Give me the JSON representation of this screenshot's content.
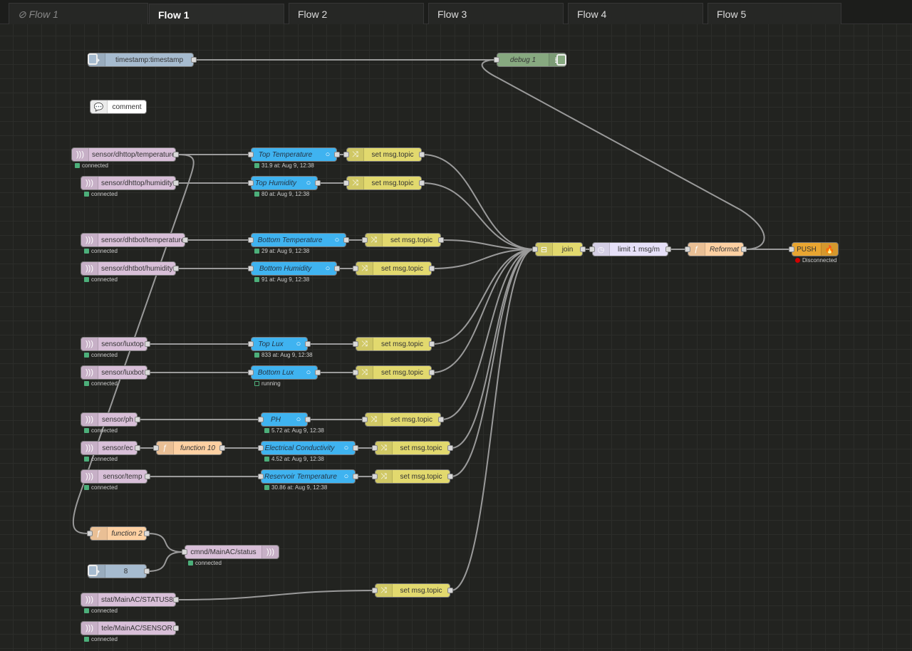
{
  "tabs": [
    {
      "label": "Flow 1",
      "state": "disabled"
    },
    {
      "label": "Flow 1",
      "state": "active"
    },
    {
      "label": "Flow 2"
    },
    {
      "label": "Flow 3"
    },
    {
      "label": "Flow 4"
    },
    {
      "label": "Flow 5"
    }
  ],
  "tab_disabled_icon": "⊘",
  "colors": {
    "inject": "#a6bbcf",
    "debug": "#87a980",
    "comment": "#ffffff",
    "mqtt": "#d8bfd8",
    "ui": "#3fb3f0",
    "change": "#e2d96e",
    "delay": "#e6e0f8",
    "function": "#fdd0a2",
    "push": "#e8a531",
    "status_ok": "#4caf7a",
    "status_err": "#d00000"
  },
  "nodes": {
    "ts": {
      "label": "timestamp:timestamp",
      "icon": "arrow-right-icon"
    },
    "debug": {
      "label": "debug 1",
      "icon": "list-icon"
    },
    "comment": {
      "label": "comment",
      "icon": "speech-bubble-icon"
    },
    "m1": {
      "label": "sensor/dhttop/temperature",
      "status": "connected"
    },
    "m2": {
      "label": "sensor/dhttop/humidity",
      "status": "connected"
    },
    "m3": {
      "label": "sensor/dhtbot/temperature",
      "status": "connected"
    },
    "m4": {
      "label": "sensor/dhtbot/humidity",
      "status": "connected"
    },
    "m5": {
      "label": "sensor/luxtop",
      "status": "connected"
    },
    "m6": {
      "label": "sensor/luxbot",
      "status": "connected"
    },
    "m7": {
      "label": "sensor/ph",
      "status": "connected"
    },
    "m8": {
      "label": "sensor/ec",
      "status": "connected"
    },
    "m9": {
      "label": "sensor/temp",
      "status": "connected"
    },
    "m10": {
      "label": "stat/MainAC/STATUS8",
      "status": "connected"
    },
    "m11": {
      "label": "tele/MainAC/SENSOR",
      "status": "connected"
    },
    "g1": {
      "label": "Top Temperature",
      "status": "31.9 at: Aug 9, 12:38"
    },
    "g2": {
      "label": "Top Humidity",
      "status": "80 at: Aug 9, 12:38"
    },
    "g3": {
      "label": "Bottom Temperature",
      "status": "29 at: Aug 9, 12:38"
    },
    "g4": {
      "label": "Bottom Humidity",
      "status": "91 at: Aug 9, 12:38"
    },
    "g5": {
      "label": "Top Lux",
      "status": "833 at: Aug 9, 12:38"
    },
    "g6": {
      "label": "Bottom Lux",
      "status": "running",
      "status_ring": true
    },
    "g7": {
      "label": "PH",
      "status": "5.72 at: Aug 9, 12:38"
    },
    "g8": {
      "label": "Electrical Conductivity",
      "status": "4.52 at: Aug 9, 12:38"
    },
    "g9": {
      "label": "Reservoir Temperature",
      "status": "30.86 at: Aug 9, 12:38"
    },
    "c1": {
      "label": "set msg.topic"
    },
    "c2": {
      "label": "set msg.topic"
    },
    "c3": {
      "label": "set msg.topic"
    },
    "c4": {
      "label": "set msg.topic"
    },
    "c5": {
      "label": "set msg.topic"
    },
    "c6": {
      "label": "set msg.topic"
    },
    "c7": {
      "label": "set msg.topic"
    },
    "c8": {
      "label": "set msg.topic"
    },
    "c9": {
      "label": "set msg.topic"
    },
    "c10": {
      "label": "set msg.topic"
    },
    "join": {
      "label": "join"
    },
    "limit": {
      "label": "limit 1 msg/m"
    },
    "reformat": {
      "label": "Reformat"
    },
    "push": {
      "label": "PUSH",
      "status": "Disconnected",
      "status_error": true
    },
    "f10": {
      "label": "function 10"
    },
    "f2": {
      "label": "function 2"
    },
    "cmnd": {
      "label": "cmnd/MainAC/status",
      "status": "connected"
    },
    "inj8": {
      "label": "8"
    }
  }
}
